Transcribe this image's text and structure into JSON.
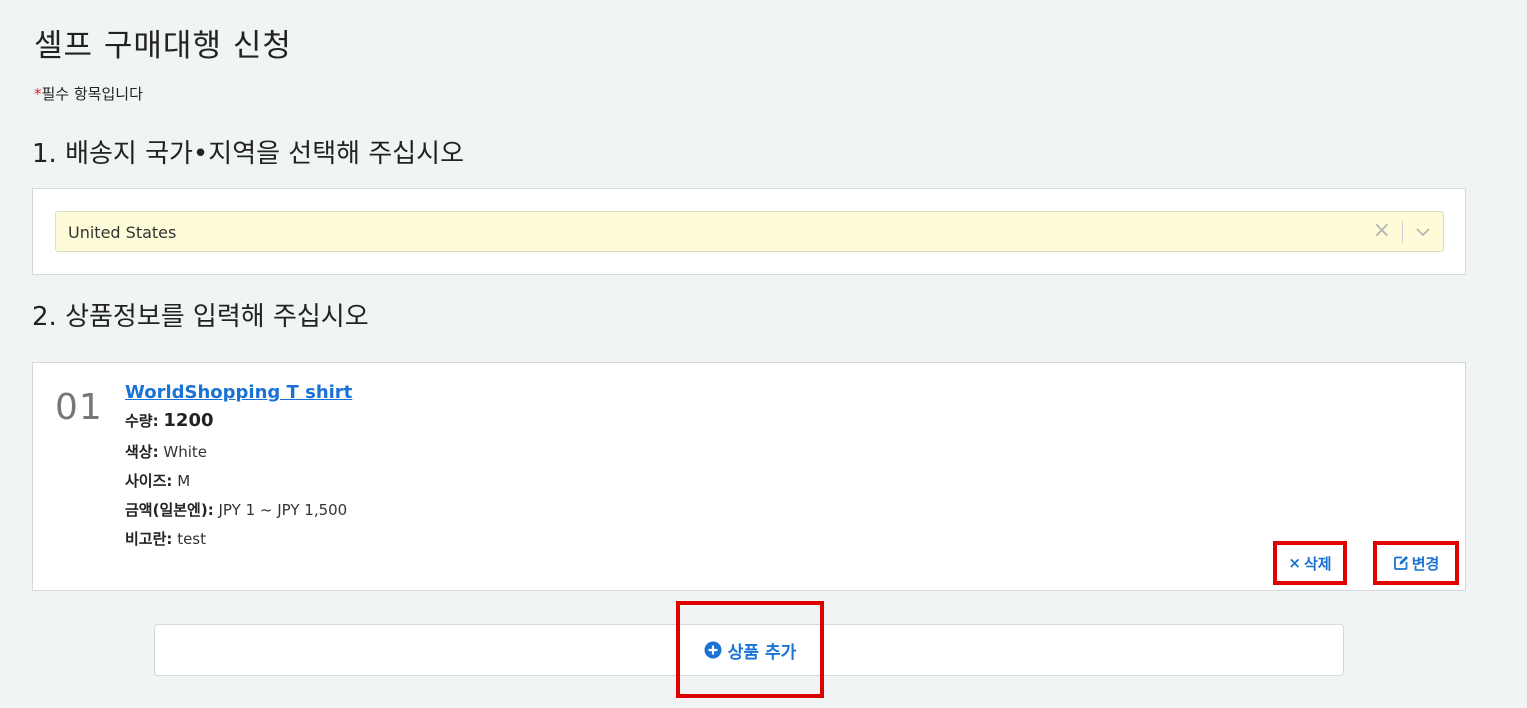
{
  "page": {
    "title": "셀프 구매대행 신청",
    "required_star": "*",
    "required_note": "필수 항목입니다"
  },
  "section1": {
    "title": "1. 배송지 국가•지역을 선택해 주십시오",
    "selected_country": "United States",
    "clear_symbol": "×"
  },
  "section2": {
    "title": "2. 상품정보를 입력해 주십시오",
    "items": [
      {
        "number": "01",
        "name": "WorldShopping T shirt",
        "quantity_label": "수량:",
        "quantity": "1200",
        "color_label": "색상:",
        "color": "White",
        "size_label": "사이즈:",
        "size": "M",
        "price_label": "금액(일본엔):",
        "price": "JPY 1 ~ JPY 1,500",
        "note_label": "비고란:",
        "note": "test"
      }
    ],
    "delete_label": "삭제",
    "delete_symbol": "×",
    "edit_label": "변경",
    "add_label": "상품 추가"
  },
  "colors": {
    "link": "#1a73d4",
    "highlight": "#e00000",
    "select_bg": "#fefbd8",
    "page_bg": "#f1f4f4"
  },
  "icons": {
    "clear": "close-icon",
    "chevron": "chevron-down-icon",
    "edit": "edit-icon",
    "add": "plus-circle-icon"
  }
}
